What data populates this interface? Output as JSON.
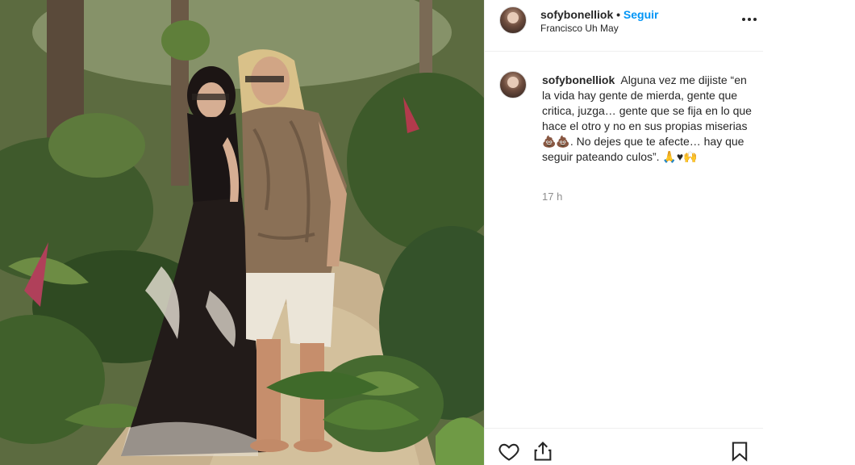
{
  "post": {
    "username": "sofybonelliok",
    "separator": "•",
    "follow_label": "Seguir",
    "location": "Francisco Uh May",
    "more_icon": "more-horizontal-icon"
  },
  "caption": {
    "username": "sofybonelliok",
    "text": "Alguna vez me dijiste “en la vida hay gente de mierda, gente que critica, juzga… gente que se fija en lo que hace el otro y no en sus propias miserias💩💩. No dejes que te afecte… hay que seguir pateando culos”. 🙏♥🙌",
    "timestamp": "17 h"
  },
  "actions": {
    "like_icon": "heart-icon",
    "share_icon": "share-icon",
    "save_icon": "bookmark-icon"
  },
  "colors": {
    "accent": "#0095f6",
    "text": "#262626",
    "muted": "#8e8e8e",
    "divider": "#efefef"
  }
}
